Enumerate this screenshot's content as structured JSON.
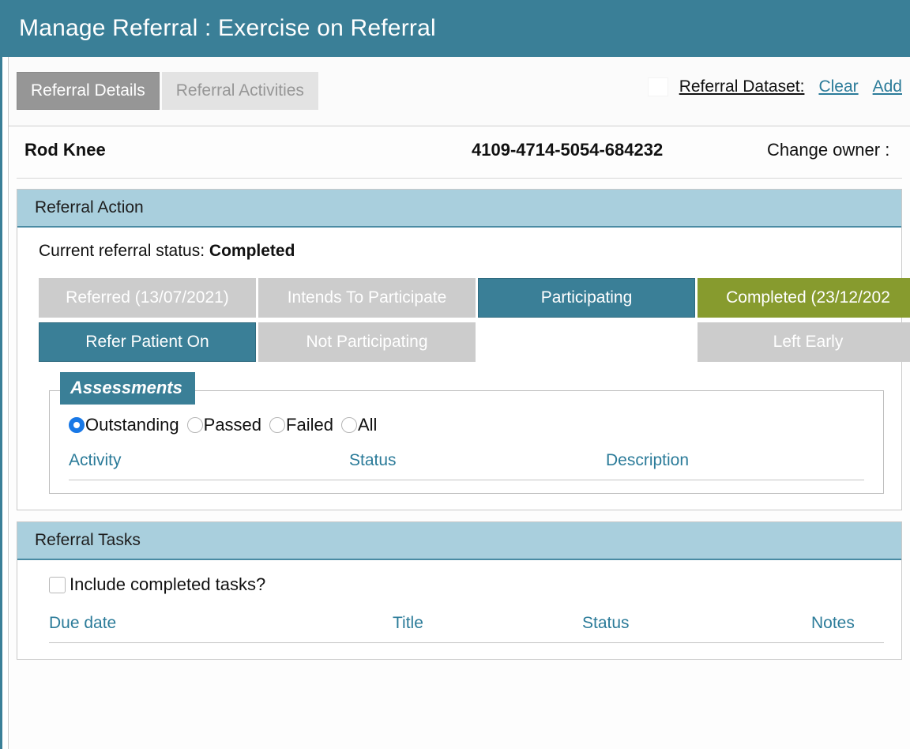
{
  "header": {
    "title": "Manage Referral : Exercise on Referral",
    "background": "#3a7f97"
  },
  "tabs": [
    {
      "label": "Referral Details",
      "active": true
    },
    {
      "label": "Referral Activities",
      "active": false
    }
  ],
  "dataset_bar": {
    "label": "Referral Dataset:",
    "clear_link": "Clear",
    "add_link": "Add"
  },
  "patient": {
    "name": "Rod Knee",
    "nhs_number": "4109-4714-5054-684232",
    "change_owner_label": "Change owner :"
  },
  "referral_action": {
    "panel_title": "Referral Action",
    "status_prefix": "Current referral status:",
    "status_value": "Completed",
    "buttons": [
      {
        "label": "Referred (13/07/2021)",
        "state": "grey"
      },
      {
        "label": "Intends To Participate",
        "state": "grey"
      },
      {
        "label": "Participating",
        "state": "teal"
      },
      {
        "label": "Completed (23/12/202",
        "state": "olive"
      },
      {
        "label": "Refer Patient On",
        "state": "teal"
      },
      {
        "label": "Not Participating",
        "state": "grey"
      },
      {
        "label": "",
        "state": "empty"
      },
      {
        "label": "Left Early",
        "state": "grey"
      }
    ],
    "assessments": {
      "legend": "Assessments",
      "filters": [
        {
          "label": "Outstanding",
          "selected": true
        },
        {
          "label": "Passed",
          "selected": false
        },
        {
          "label": "Failed",
          "selected": false
        },
        {
          "label": "All",
          "selected": false
        }
      ],
      "columns": [
        "Activity",
        "Status",
        "Description"
      ],
      "rows": []
    }
  },
  "referral_tasks": {
    "panel_title": "Referral Tasks",
    "include_completed_label": "Include completed tasks?",
    "include_completed_checked": false,
    "columns": [
      "Due date",
      "Title",
      "Status",
      "Notes"
    ],
    "rows": []
  },
  "colors": {
    "brand_teal": "#3a7f97",
    "panel_head": "#a9cfdd",
    "olive": "#879b2e",
    "grey_button": "#cccccc",
    "link_teal": "#2b7b99"
  }
}
